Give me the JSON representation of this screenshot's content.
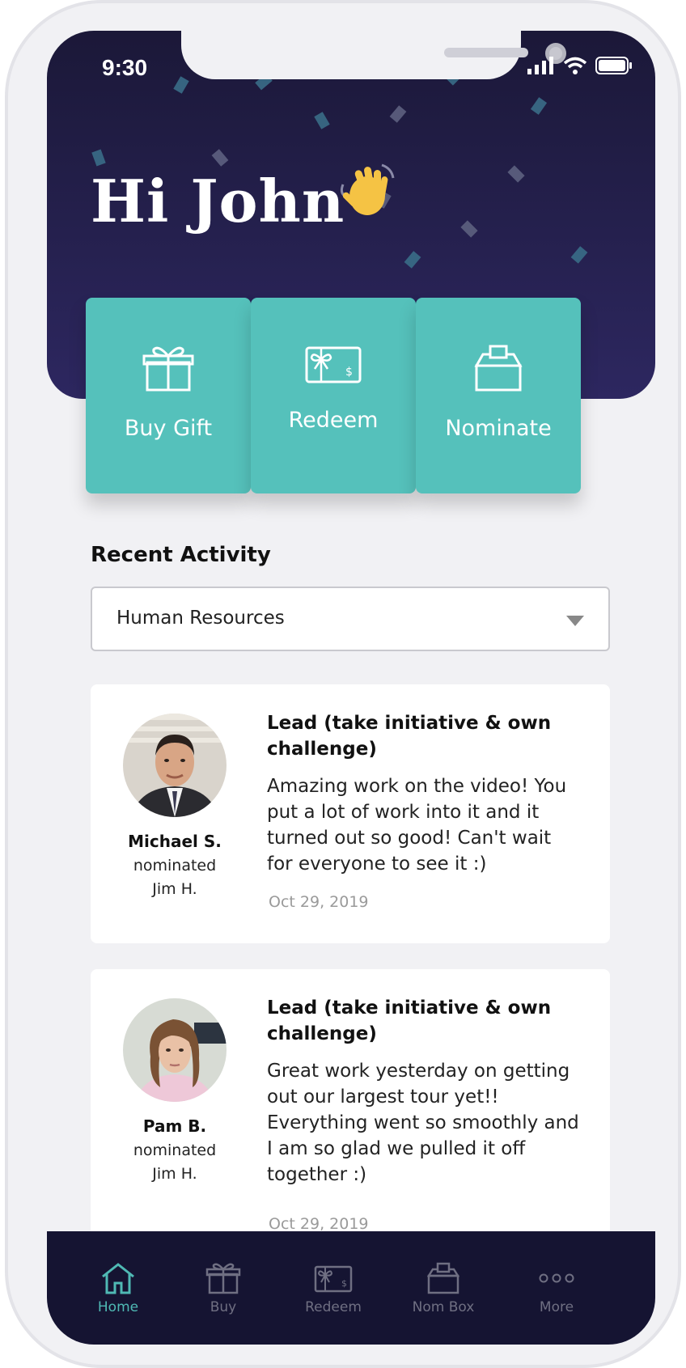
{
  "status_bar": {
    "time": "9:30"
  },
  "greeting": {
    "text": "Hi John"
  },
  "actions": [
    {
      "label": "Buy Gift",
      "icon": "gift-icon"
    },
    {
      "label": "Redeem",
      "icon": "gift-card-icon"
    },
    {
      "label": "Nominate",
      "icon": "ballot-box-icon"
    }
  ],
  "recent_activity": {
    "title": "Recent Activity",
    "filter": {
      "selected": "Human Resources"
    },
    "items": [
      {
        "nominator": "Michael S.",
        "action": "nominated",
        "nominee": "Jim H.",
        "value_title": "Lead (take initiative & own challenge)",
        "message": "Amazing work on the video! You put a lot of work into it and it turned out so good! Can't wait for everyone to see it :)",
        "date": "Oct 29, 2019"
      },
      {
        "nominator": "Pam B.",
        "action": "nominated",
        "nominee": "Jim H.",
        "value_title": "Lead (take initiative & own challenge)",
        "message": "Great work yesterday on getting out our largest tour yet!! Everything went so smoothly and I am so glad we pulled it off together :)",
        "date": "Oct 29, 2019"
      }
    ]
  },
  "tabbar": [
    {
      "label": "Home",
      "icon": "home-icon",
      "active": true
    },
    {
      "label": "Buy",
      "icon": "gift-icon",
      "active": false
    },
    {
      "label": "Redeem",
      "icon": "gift-card-icon",
      "active": false
    },
    {
      "label": "Nom Box",
      "icon": "ballot-box-icon",
      "active": false
    },
    {
      "label": "More",
      "icon": "more-icon",
      "active": false
    }
  ],
  "colors": {
    "hero": "#241f4e",
    "accent": "#55c1bb",
    "tabbar": "#151432",
    "active_tab": "#4fb9b4"
  }
}
